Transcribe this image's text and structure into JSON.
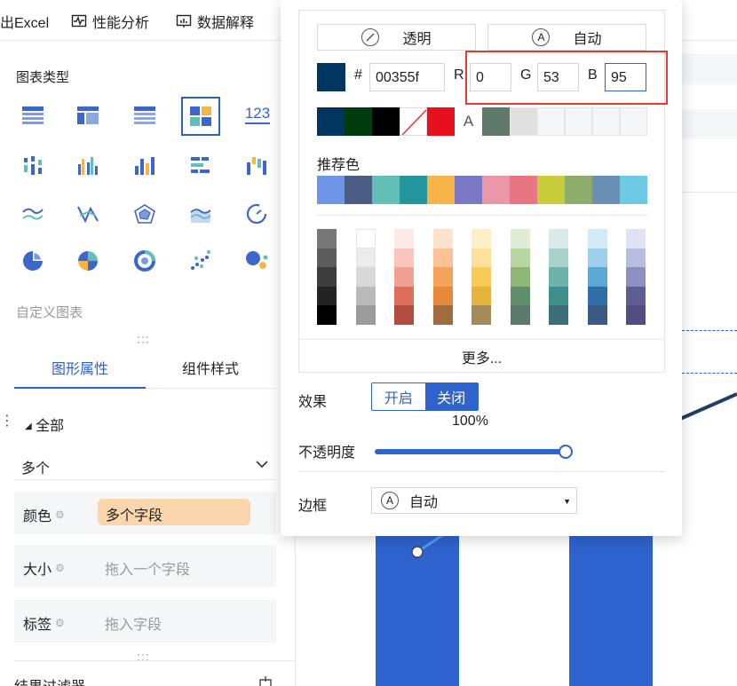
{
  "toolbar": {
    "export_label": "出Excel",
    "perf_label": "性能分析",
    "explain_label": "数据解释"
  },
  "left_panel": {
    "chart_types_title": "图表类型",
    "chart_type_icons": [
      "table-icon",
      "cross-table-icon",
      "detail-table-icon",
      "grouped-table-icon",
      "kpi-number-icon",
      "scatter-bar-icon",
      "grouped-bar-icon",
      "bar-chart-icon",
      "horizontal-bar-icon",
      "waterfall-icon",
      "line-chart-icon",
      "radar-icon",
      "polar-chart-icon",
      "area-chart-icon",
      "gauge-icon",
      "pie-chart-icon",
      "rose-chart-icon",
      "donut-chart-icon",
      "scatter-chart-icon",
      "bubble-chart-icon"
    ],
    "selected_chart_type": "grouped-table-icon",
    "kpi_number_text": "123",
    "custom_chart_label": "自定义图表",
    "tabs": [
      "图形属性",
      "组件样式"
    ],
    "active_tab": "图形属性",
    "all_label": "全部",
    "multi_label": "多个",
    "fields": [
      {
        "label": "颜色",
        "value": "多个字段",
        "is_pill": true
      },
      {
        "label": "大小",
        "value": "拖入一个字段",
        "is_pill": false
      },
      {
        "label": "标签",
        "value": "拖入字段",
        "is_pill": false
      }
    ],
    "filter_label": "结果过滤器"
  },
  "color_popup": {
    "transparent_label": "透明",
    "auto_label": "自动",
    "hex_prefix": "#",
    "hex_value": "00355f",
    "r_label": "R",
    "r_value": "0",
    "g_label": "G",
    "g_value": "53",
    "b_label": "B",
    "b_value": "95",
    "current_color": "#00355f",
    "recent_colors": [
      "#00355f",
      "#003b0e",
      "#000000",
      "none",
      "#e8101f",
      "A",
      "#5f7a6a",
      "#e0e0e0",
      "#f5f6f8",
      "#f5f6f8",
      "#f5f6f8",
      "#f5f6f8"
    ],
    "recommended_title": "推荐色",
    "recommended_colors": [
      "#6f95e8",
      "#4b5d82",
      "#62bfb5",
      "#24959c",
      "#f7b448",
      "#7b78c6",
      "#e896a8",
      "#e87582",
      "#c7cd3b",
      "#8eac6c",
      "#6a8fb5",
      "#6ec8e4"
    ],
    "palette_columns": [
      [
        "#777777",
        "#5c5c5c",
        "#3d3d3d",
        "#232323",
        "#000000"
      ],
      [
        "#ffffff",
        "#ececec",
        "#d8d8d8",
        "#bababa",
        "#9c9c9c"
      ],
      [
        "#fde9e6",
        "#f9c5bd",
        "#f0a193",
        "#df6f5b",
        "#b34b3f"
      ],
      [
        "#fde3cd",
        "#fbc296",
        "#f3a35a",
        "#e6893b",
        "#a06c3d"
      ],
      [
        "#fdf0c8",
        "#fde09a",
        "#f7cb55",
        "#e6b33b",
        "#a48c5a"
      ],
      [
        "#deedd3",
        "#b7d6a2",
        "#8fb577",
        "#5f8e6b",
        "#5b7a6a"
      ],
      [
        "#d9ece8",
        "#a7d3cb",
        "#6db3a9",
        "#3f8f8c",
        "#3e6e7a"
      ],
      [
        "#d2ebf6",
        "#9fd0eb",
        "#5ea8d6",
        "#2f6ea9",
        "#3a5a83"
      ],
      [
        "#dfe2f1",
        "#b8bcdf",
        "#8c8fc1",
        "#5f5b95",
        "#4f4f7f"
      ]
    ],
    "more_label": "更多...",
    "effect_label": "效果",
    "effect_on": "开启",
    "effect_off": "关闭",
    "opacity_label": "不透明度",
    "opacity_value": "100%",
    "opacity_fraction": 1.0,
    "border_label": "边框",
    "border_value": "自动"
  }
}
